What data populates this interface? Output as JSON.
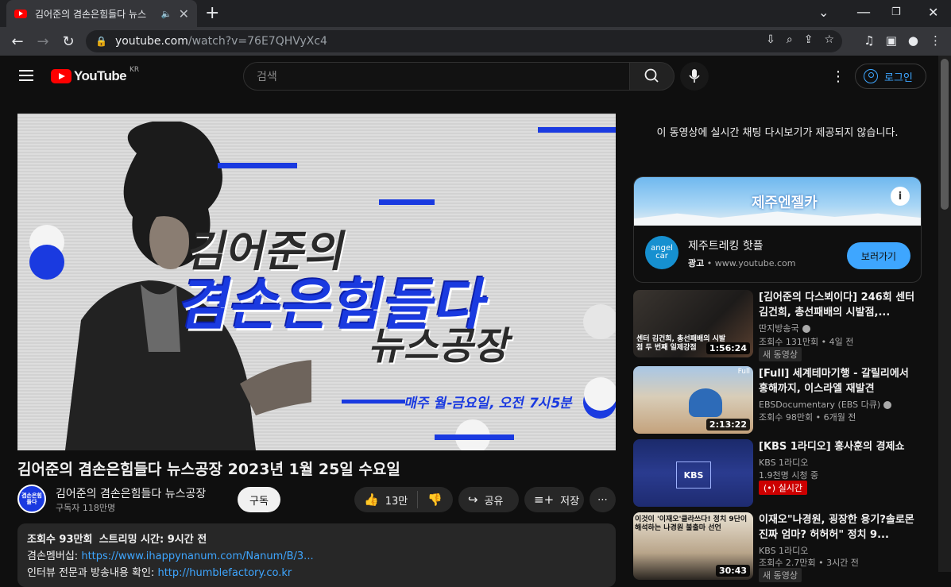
{
  "browser": {
    "tab_title": "김어준의 겸손은힘들다 뉴스",
    "url_host": "youtube.com",
    "url_path": "/watch?v=76E7QHVyXc4"
  },
  "header": {
    "logo_text": "YouTube",
    "region": "KR",
    "search_placeholder": "검색",
    "login_label": "로그인"
  },
  "player": {
    "thumb_line1": "김어준의",
    "thumb_line2": "겸손은힘들다",
    "thumb_line3": "뉴스공장",
    "thumb_schedule": "매주 월-금요일, 오전 7시5분"
  },
  "video": {
    "title": "김어준의 겸손은힘들다 뉴스공장 2023년 1월 25일 수요일",
    "channel": "김어준의 겸손은힘들다 뉴스공장",
    "channel_avatar_text": "겸손은힘들다",
    "subscribers": "구독자 118만명",
    "subscribe_label": "구독",
    "likes": "13만",
    "share_label": "공유",
    "save_label": "저장",
    "desc_views": "조회수 93만회",
    "desc_stream": "스트리밍 시간: 9시간 전",
    "desc_line2_label": "겸손멤버십:",
    "desc_line2_link": "https://www.ihappynanum.com/Nanum/B/3...",
    "desc_line3_label": "인터뷰 전문과 방송내용 확인:",
    "desc_line3_link": "http://humblefactory.co.kr"
  },
  "sidebar": {
    "chat_note": "이 동영상에 실시간 채팅 다시보기가 제공되지 않습니다.",
    "ad": {
      "brand": "제주엔젤카",
      "logo_text": "angel car",
      "title": "제주트레킹 핫플",
      "label": "광고",
      "domain": "www.youtube.com",
      "cta": "보러가기"
    },
    "recs": [
      {
        "title": "[김어준의 다스뵈이다] 246회 센터 김건희, 총선패배의 시발점,...",
        "channel": "딴지방송국",
        "meta": "조회수 131만회 • 4일 전",
        "badge": "새 동영상",
        "duration": "1:56:24",
        "thumb_caption": "센터 김건희, 총선패배의 시발점 두 번째 일제강점"
      },
      {
        "title": "[Full] 세계테마기행 - 갈릴리에서 홍해까지, 이스라엘 재발견",
        "channel": "EBSDocumentary (EBS 다큐)",
        "meta": "조회수 98만회 • 6개월 전",
        "badge": "",
        "duration": "2:13:22",
        "thumb_caption": "Full"
      },
      {
        "title": "[KBS 1라디오] 홍사훈의 경제쇼",
        "channel": "KBS 1라디오",
        "meta": "1.9천명 시청 중",
        "badge": "실시간",
        "duration": "",
        "thumb_caption": "KBS"
      },
      {
        "title": "이재오\"나경원, 굉장한 용기?솔로몬 진짜 엄마? 허허허\" 정치 9...",
        "channel": "KBS 1라디오",
        "meta": "조회수 2.7만회 • 3시간 전",
        "badge": "새 동영상",
        "duration": "30:43",
        "thumb_caption": "이것이 '이재오'클라쓰다! 정치 9단이 해석하는 나경원 불출마 선언"
      }
    ]
  }
}
